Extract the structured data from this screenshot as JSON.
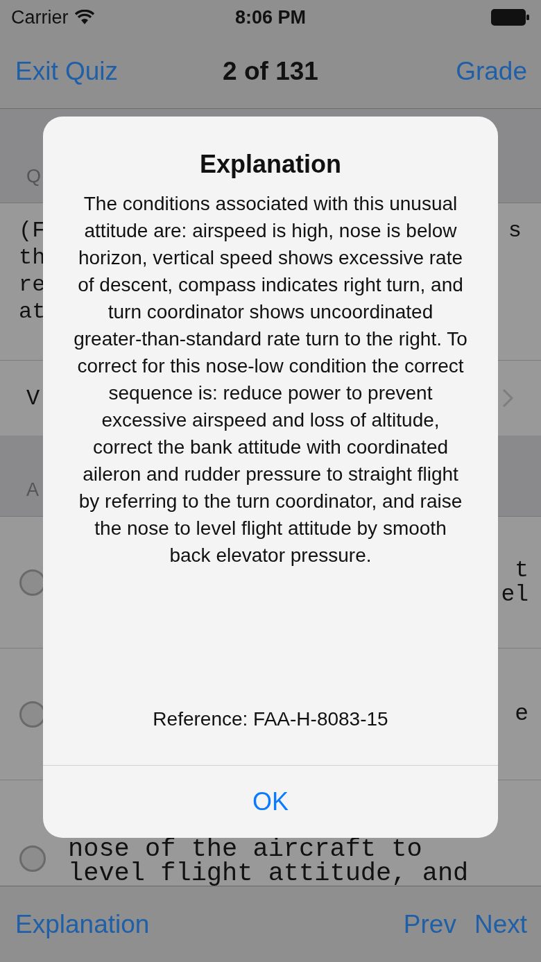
{
  "status_bar": {
    "carrier": "Carrier",
    "time": "8:06 PM"
  },
  "nav_bar": {
    "left": "Exit Quiz",
    "title": "2 of 131",
    "right": "Grade"
  },
  "question_header": {
    "text": "Q"
  },
  "question_lines": [
    {
      "left": "(F",
      "right": "s"
    },
    {
      "left": "th"
    },
    {
      "left": "re"
    },
    {
      "left": "at"
    }
  ],
  "view_row": {
    "text": "V"
  },
  "answers_header": {
    "text": "A"
  },
  "answers": [
    {
      "selected": false,
      "lines": [
        {
          "right": "t"
        },
        {
          "right": "el"
        }
      ]
    },
    {
      "selected": false,
      "lines": [
        {
          "right": "e"
        }
      ]
    },
    {
      "selected": false,
      "lines": [
        {
          "left": "nose of the aircraft to"
        },
        {
          "left": "level flight attitude, and"
        }
      ]
    }
  ],
  "toolbar": {
    "left": "Explanation",
    "prev": "Prev",
    "next": "Next"
  },
  "alert": {
    "title": "Explanation",
    "message": "The conditions associated with this unusual attitude are: airspeed is high, nose is below horizon, vertical speed shows excessive rate of descent, compass indicates right turn, and turn coordinator shows uncoordinated greater-than-standard rate turn to the right. To correct for this nose-low condition the correct sequence is: reduce power to prevent excessive airspeed and loss of altitude, correct the bank attitude with coordinated aileron and rudder pressure to straight flight by referring to the turn coordinator, and raise the nose to level flight attitude by smooth back elevator pressure.",
    "reference": "Reference: FAA-H-8083-15",
    "button": "OK"
  }
}
